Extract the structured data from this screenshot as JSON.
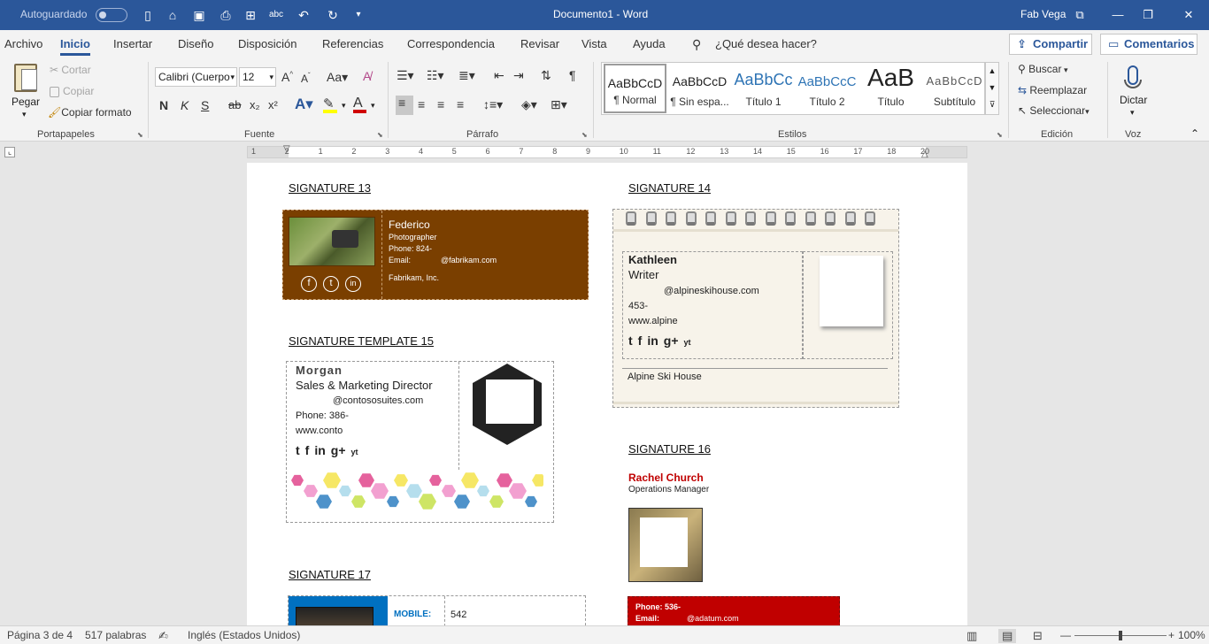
{
  "titlebar": {
    "autosave": "Autoguardado",
    "title": "Documento1  -  Word",
    "user": "Fab Vega"
  },
  "tabs": [
    "Archivo",
    "Inicio",
    "Insertar",
    "Diseño",
    "Disposición",
    "Referencias",
    "Correspondencia",
    "Revisar",
    "Vista",
    "Ayuda"
  ],
  "tellme": "¿Qué desea hacer?",
  "share": "Compartir",
  "comments": "Comentarios",
  "clipboard": {
    "paste": "Pegar",
    "cut": "Cortar",
    "copy": "Copiar",
    "format_painter": "Copiar formato",
    "group": "Portapapeles"
  },
  "font": {
    "name": "Calibri (Cuerpo",
    "size": "12",
    "bold": "N",
    "italic": "K",
    "underline": "S",
    "strike": "ab",
    "sub": "x₂",
    "sup": "x²",
    "group": "Fuente"
  },
  "paragraph": {
    "group": "Párrafo"
  },
  "styles": {
    "group": "Estilos",
    "items": [
      {
        "preview": "AaBbCcD",
        "name": "¶ Normal"
      },
      {
        "preview": "AaBbCcD",
        "name": "¶ Sin espa..."
      },
      {
        "preview": "AaBbCc",
        "name": "Título 1"
      },
      {
        "preview": "AaBbCcC",
        "name": "Título 2"
      },
      {
        "preview": "AaB",
        "name": "Título"
      },
      {
        "preview": "AaBbCcD",
        "name": "Subtítulo"
      }
    ]
  },
  "editing": {
    "find": "Buscar",
    "replace": "Reemplazar",
    "select": "Seleccionar",
    "group": "Edición"
  },
  "voice": {
    "dictate": "Dictar",
    "group": "Voz"
  },
  "ruler_ticks": [
    "1",
    "2",
    "1",
    "2",
    "3",
    "4",
    "5",
    "6",
    "7",
    "8",
    "9",
    "10",
    "11",
    "12",
    "13",
    "14",
    "15",
    "16",
    "17",
    "18",
    "20"
  ],
  "doc": {
    "sig13": {
      "heading": "SIGNATURE 13",
      "name": "Federico",
      "title": "Photographer",
      "phone": "Phone: 824-",
      "email_label": "Email:",
      "email": "@fabrikam.com",
      "company": "Fabrikam, Inc.",
      "social": [
        "f",
        "t",
        "in"
      ]
    },
    "sig14": {
      "heading": "SIGNATURE 14",
      "name": "Kathleen",
      "title": "Writer",
      "email": "@alpineskihouse.com",
      "phone": "453-",
      "web": "www.alpine",
      "company": "Alpine Ski House",
      "social": [
        "t",
        "f",
        "in",
        "g+",
        "yt"
      ]
    },
    "sig15": {
      "heading": "SIGNATURE TEMPLATE 15",
      "name": "Morgan",
      "title": "Sales & Marketing Director",
      "email": "@contososuites.com",
      "phone": "Phone: 386-",
      "web": "www.conto",
      "social": [
        "t",
        "f",
        "in",
        "g+",
        "yt"
      ]
    },
    "sig16": {
      "heading": "SIGNATURE 16",
      "name": "Rachel Church",
      "title": "Operations Manager",
      "phone": "Phone: 536-",
      "email_label": "Email:",
      "email": "@adatum.com"
    },
    "sig17": {
      "heading": "SIGNATURE 17",
      "mobile_label": "MOBILE:",
      "mobile": "542"
    }
  },
  "status": {
    "page": "Página 3 de 4",
    "words": "517 palabras",
    "lang": "Inglés (Estados Unidos)",
    "zoom": "100%"
  },
  "colors": {
    "brand": "#2b579a",
    "sig13_bg": "#7a3f00",
    "sig16_red": "#c00000",
    "sig17_blue": "#0070c0"
  }
}
